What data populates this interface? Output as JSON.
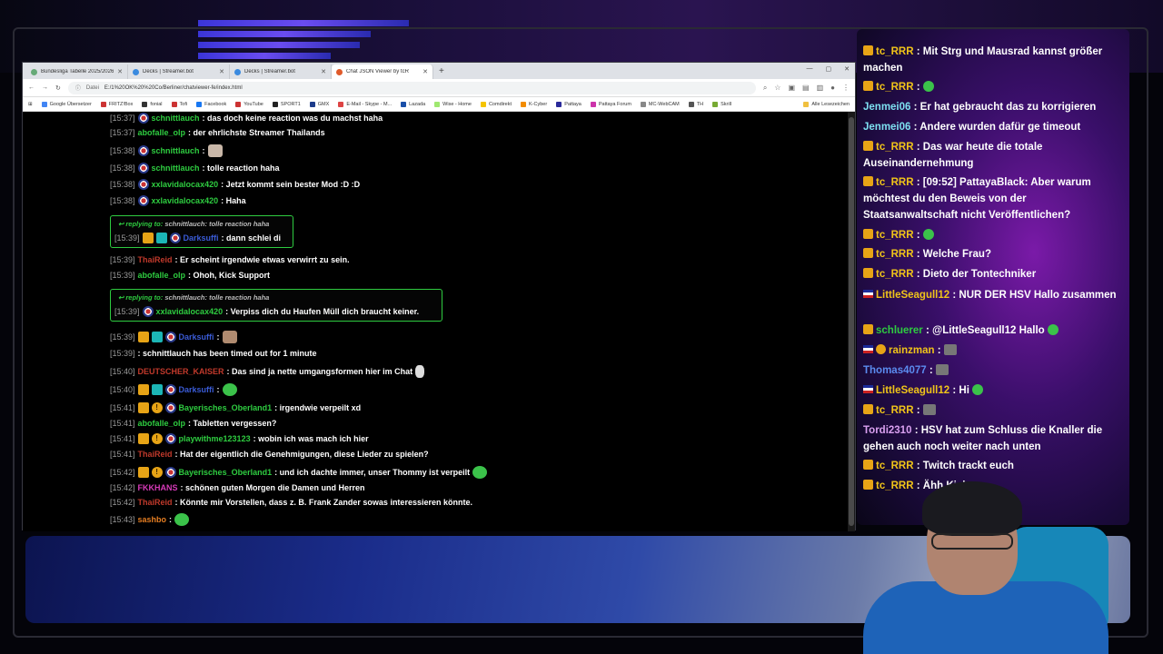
{
  "browser": {
    "tabs": [
      {
        "label": "Bundesliga Tabelle 2025/2026"
      },
      {
        "label": "Decks | Streamer.bot"
      },
      {
        "label": "Decks | Streamer.bot"
      },
      {
        "label": "Chat JSON Viewer by tcR"
      }
    ],
    "url_label": "Datei",
    "url": "E:/1%20OK%20%20Co/Berliner/chatviewer-fe/index.html",
    "bookmarks": [
      "Google Übersetzer",
      "FRITZ!Box",
      "fonial",
      "Tofi",
      "Facebook",
      "YouTube",
      "SPORT1",
      "GMX",
      "E-Mail - Skype - M...",
      "Lazada",
      "Wise - Home",
      "Comdirekt",
      "K-Cyber",
      "Pattaya",
      "Pattaya Forum",
      "MC-WebCAM",
      "TH",
      "Skrill",
      "Alle Lesezeichen"
    ]
  },
  "chat": {
    "messages": [
      {
        "ts": "[15:37]",
        "user": "schnittlauch",
        "color": "#2ecc40",
        "text": ": das doch keine reaction was du machst haha"
      },
      {
        "ts": "[15:37]",
        "user": "abofalle_olp",
        "color": "#2ecc40",
        "text": ": der ehrlichste Streamer Thailands"
      },
      {
        "ts": "[15:38]",
        "user": "schnittlauch",
        "color": "#2ecc40",
        "text": ":"
      },
      {
        "ts": "[15:38]",
        "user": "schnittlauch",
        "color": "#2ecc40",
        "text": ": tolle reaction haha"
      },
      {
        "ts": "[15:38]",
        "user": "xxlavidalocax420",
        "color": "#2ecc40",
        "text": ": Jetzt kommt sein bester Mod :D :D"
      },
      {
        "ts": "[15:38]",
        "user": "xxlavidalocax420",
        "color": "#2ecc40",
        "text": ": Haha"
      },
      {
        "ts": "[15:39]",
        "user": "ThaiReid",
        "color": "#c0392b",
        "text": ": Er scheint irgendwie etwas verwirrt zu sein."
      },
      {
        "ts": "[15:39]",
        "user": "abofalle_olp",
        "color": "#2ecc40",
        "text": ": Ohoh, Kick Support"
      },
      {
        "ts": "[15:39]",
        "user": "Darksuffi",
        "color": "#3a5bd6",
        "text": ":"
      },
      {
        "ts": "[15:39]",
        "user": "",
        "color": "#fff",
        "text": ": schnittlauch has been timed out for 1 minute"
      },
      {
        "ts": "[15:40]",
        "user": "DEUTSCHER_KAISER",
        "color": "#c0392b",
        "text": ": Das sind ja nette umgangsformen hier im Chat"
      },
      {
        "ts": "[15:40]",
        "user": "Darksuffi",
        "color": "#3a5bd6",
        "text": ":"
      },
      {
        "ts": "[15:41]",
        "user": "Bayerisches_Oberland1",
        "color": "#2ecc40",
        "text": ": irgendwie verpeilt xd"
      },
      {
        "ts": "[15:41]",
        "user": "abofalle_olp",
        "color": "#2ecc40",
        "text": ": Tabletten vergessen?"
      },
      {
        "ts": "[15:41]",
        "user": "playwithme123123",
        "color": "#2ecc40",
        "text": ": wobin ich was mach ich hier"
      },
      {
        "ts": "[15:41]",
        "user": "ThaiReid",
        "color": "#c0392b",
        "text": ": Hat der eigentlich die Genehmigungen, diese Lieder zu spielen?"
      },
      {
        "ts": "[15:42]",
        "user": "Bayerisches_Oberland1",
        "color": "#2ecc40",
        "text": ": und ich dachte immer, unser Thommy ist verpeilt"
      },
      {
        "ts": "[15:42]",
        "user": "FKKHANS",
        "color": "#d63ab8",
        "text": ": schönen guten Morgen die Damen und Herren"
      },
      {
        "ts": "[15:42]",
        "user": "ThaiReid",
        "color": "#c0392b",
        "text": ": Könnte mir Vorstellen, dass z. B. Frank Zander sowas interessieren könnte."
      },
      {
        "ts": "[15:43]",
        "user": "sashbo",
        "color": "#e67e22",
        "text": ":"
      }
    ],
    "replies": [
      {
        "prefix": "replying to:",
        "context": "schnittlauch: tolle reaction haha",
        "ts": "[15:39]",
        "user": "Darksuffi",
        "color": "#3a5bd6",
        "text": ": dann schlei di"
      },
      {
        "prefix": "replying to:",
        "context": "schnittlauch: tolle reaction haha",
        "ts": "[15:39]",
        "user": "xxlavidalocax420",
        "color": "#2ecc40",
        "text": ": Verpiss dich du Haufen Müll dich braucht keiner."
      }
    ]
  },
  "overlay": {
    "messages": [
      {
        "user": "tc_RRR",
        "color": "#f0c419",
        "text": ": Mit Strg und Mausrad kannst größer machen"
      },
      {
        "user": "tc_RRR",
        "color": "#f0c419",
        "text": ":"
      },
      {
        "user": "Jenmei06",
        "color": "#7de0f0",
        "text": ": Er hat gebraucht das zu korrigieren"
      },
      {
        "user": "Jenmei06",
        "color": "#7de0f0",
        "text": ": Andere wurden dafür ge timeout"
      },
      {
        "user": "tc_RRR",
        "color": "#f0c419",
        "text": ": Das war heute die totale Auseinandernehmung"
      },
      {
        "user": "tc_RRR",
        "color": "#f0c419",
        "text": ": [09:52] PattayaBlack: Aber warum möchtest du den Beweis von der Staatsanwaltschaft nicht Veröffentlichen?"
      },
      {
        "user": "tc_RRR",
        "color": "#f0c419",
        "text": ":"
      },
      {
        "user": "tc_RRR",
        "color": "#f0c419",
        "text": ": Welche Frau?"
      },
      {
        "user": "tc_RRR",
        "color": "#f0c419",
        "text": ": Dieto der Tontechniker"
      },
      {
        "user": "LittleSeagull12",
        "color": "#f0c419",
        "text": ": NUR DER HSV Hallo zusammen"
      },
      {
        "user": "schluerer",
        "color": "#2ecc40",
        "text": ": @LittleSeagull12 Hallo"
      },
      {
        "user": "rainzman",
        "color": "#f0c419",
        "text": ":"
      },
      {
        "user": "Thomas4077",
        "color": "#5b8cf0",
        "text": ":"
      },
      {
        "user": "LittleSeagull12",
        "color": "#f0c419",
        "text": ": Hi"
      },
      {
        "user": "tc_RRR",
        "color": "#f0c419",
        "text": ":"
      },
      {
        "user": "Tordi2310",
        "color": "#d9a0f0",
        "text": ": HSV hat zum Schluss die Knaller die gehen auch noch weiter nach unten"
      },
      {
        "user": "tc_RRR",
        "color": "#f0c419",
        "text": ": Twitch trackt euch"
      },
      {
        "user": "tc_RRR",
        "color": "#f0c419",
        "text": ": Ähh Kick"
      }
    ]
  }
}
